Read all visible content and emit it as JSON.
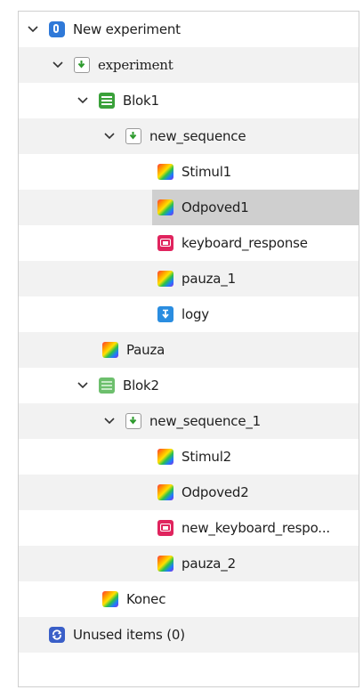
{
  "tree": {
    "root": {
      "label": "New experiment",
      "icon": "experiment-icon"
    },
    "experiment": {
      "label": "experiment",
      "icon": "sequence-icon"
    },
    "blok1": {
      "label": "Blok1",
      "icon": "loop-icon"
    },
    "new_sequence": {
      "label": "new_sequence",
      "icon": "sequence-icon"
    },
    "stimul1": {
      "label": "Stimul1",
      "icon": "sketchpad-icon"
    },
    "odpoved1": {
      "label": "Odpoved1",
      "icon": "sketchpad-icon",
      "selected": true
    },
    "keyboard_response": {
      "label": "keyboard_response",
      "icon": "keyboard-icon"
    },
    "pauza_1": {
      "label": "pauza_1",
      "icon": "sketchpad-icon"
    },
    "logy": {
      "label": "logy",
      "icon": "logger-icon"
    },
    "pauza": {
      "label": "Pauza",
      "icon": "sketchpad-icon"
    },
    "blok2": {
      "label": "Blok2",
      "icon": "loop-icon"
    },
    "new_sequence_1": {
      "label": "new_sequence_1",
      "icon": "sequence-icon"
    },
    "stimul2": {
      "label": "Stimul2",
      "icon": "sketchpad-icon"
    },
    "odpoved2": {
      "label": "Odpoved2",
      "icon": "sketchpad-icon"
    },
    "new_keyboard_response": {
      "label": "new_keyboard_respo...",
      "icon": "keyboard-icon"
    },
    "pauza_2": {
      "label": "pauza_2",
      "icon": "sketchpad-icon"
    },
    "konec": {
      "label": "Konec",
      "icon": "sketchpad-icon"
    },
    "unused": {
      "label": "Unused items (0)",
      "icon": "unused-items-icon"
    }
  },
  "colors": {
    "selection": "#cfcfcf",
    "alt_row": "#f2f2f2",
    "experiment_blue": "#2f79d8",
    "loop_green": "#3aa13a",
    "keyboard_pink": "#e0245e",
    "logger_blue": "#2a8de0"
  }
}
